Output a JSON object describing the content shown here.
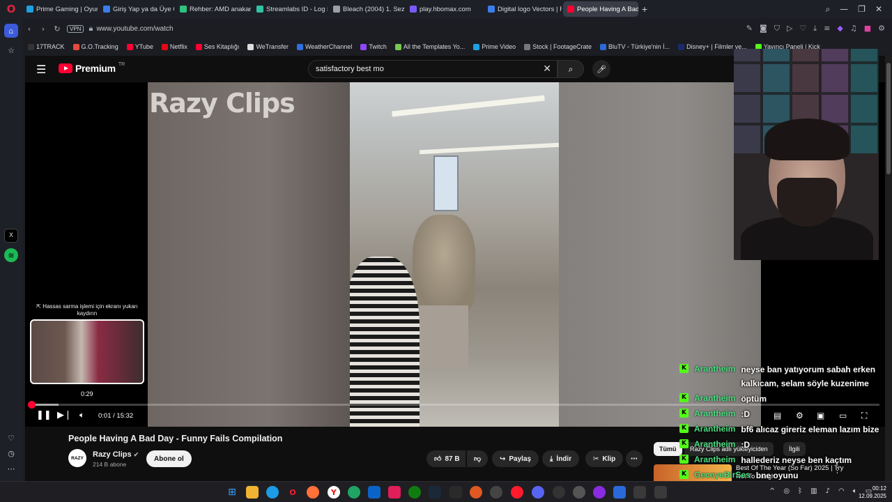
{
  "browser": {
    "tabs": [
      {
        "label": "Prime Gaming | Oyunları k",
        "color": "#1fa0e0",
        "active": false
      },
      {
        "label": "Giriş Yap ya da Üye Ol | Ar",
        "color": "#3b7de9",
        "active": false
      },
      {
        "label": "Rehber: AMD anakartlarda",
        "color": "#2ec27e",
        "active": false
      },
      {
        "label": "Streamlabs ID - Log in",
        "color": "#31c3a2",
        "active": false
      },
      {
        "label": "Bleach (2004) 1. Sezon Bö",
        "color": "#9aa0a6",
        "active": false
      },
      {
        "label": "play.hbomax.com",
        "color": "#7a5af8",
        "active": false
      },
      {
        "label": "Digital logo Vectors | Free",
        "color": "#3b7de9",
        "active": false
      },
      {
        "label": "People Having A Bad D",
        "color": "#ff0033",
        "active": true
      }
    ],
    "new_tab": "+",
    "url": "www.youtube.com/watch",
    "vpn_label": "VPN",
    "bookmarks": [
      {
        "label": "17TRACK",
        "color": "#333"
      },
      {
        "label": "G.O.Tracking",
        "color": "#e34b3c"
      },
      {
        "label": "YTube",
        "color": "#ff0033"
      },
      {
        "label": "Netflix",
        "color": "#e50914"
      },
      {
        "label": "Ses Kitaplığı",
        "color": "#ff0033"
      },
      {
        "label": "WeTransfer",
        "color": "#dddddd"
      },
      {
        "label": "WeatherChannel",
        "color": "#2f6fdf"
      },
      {
        "label": "Twitch",
        "color": "#9146ff"
      },
      {
        "label": "All the Templates Yo...",
        "color": "#78c850"
      },
      {
        "label": "Prime Video",
        "color": "#1fa0e0"
      },
      {
        "label": "Stock | FootageCrate",
        "color": "#777"
      },
      {
        "label": "BluTV - Türkiye'nin İ...",
        "color": "#2a6ad8"
      },
      {
        "label": "Disney+ | Filmler ve...",
        "color": "#1b2a6b"
      },
      {
        "label": "Yayıncı Paneli | Kick",
        "color": "#53fc18"
      }
    ]
  },
  "youtube": {
    "logo_text": "Premium",
    "region": "TR",
    "search_value": "satisfactory best mo",
    "watermark": "Razy Clips",
    "seek_hint": "⇱ Hassas sarma işlemi için ekranı yukarı kaydırın",
    "seek_preview_time": "0:29",
    "time_current": "0:01",
    "time_total": "15:32",
    "time_sep": " / ",
    "progress_played_fraction": 0.001,
    "progress_hover_fraction": 0.033,
    "video_title": "People Having A Bad Day - Funny Fails Compilation",
    "channel_name": "Razy Clips",
    "channel_avatar_text": "RAZY",
    "subscribers": "214 B abone",
    "subscribe_label": "Abone ol",
    "like_count": "87 B",
    "share_label": "Paylaş",
    "download_label": "İndir",
    "clip_label": "Klip",
    "chip_all": "Tümü",
    "chip_uploader": "Razy Clips adlı yükleyiciden",
    "chip_related": "İlgili",
    "related_title": "Best Of The Year (So Far) 2025 | Try Not To Laugh"
  },
  "chat": [
    {
      "user": "Arantheim",
      "message": "neyse ban yatıyorum sabah erken kalkıcam, selam söyle kuzenime"
    },
    {
      "user": "Arantheim",
      "message": "öptüm"
    },
    {
      "user": "Arantheim",
      "message": ":D"
    },
    {
      "user": "Arantheim",
      "message": "bf6 alıcaz gireriz eleman lazım bize"
    },
    {
      "user": "Arantheim",
      "message": ":D"
    },
    {
      "user": "Arantheim",
      "message": "hallederiz neyse ben kaçtım"
    },
    {
      "user": "GeceyeBirSes",
      "message": "bne oyunu"
    }
  ],
  "taskbar": {
    "time": "00:12",
    "date": "12.09.2025"
  },
  "colors": {
    "youtube_red": "#ff0033",
    "kick_green": "#53fc18",
    "chat_user": "#4ade80"
  }
}
